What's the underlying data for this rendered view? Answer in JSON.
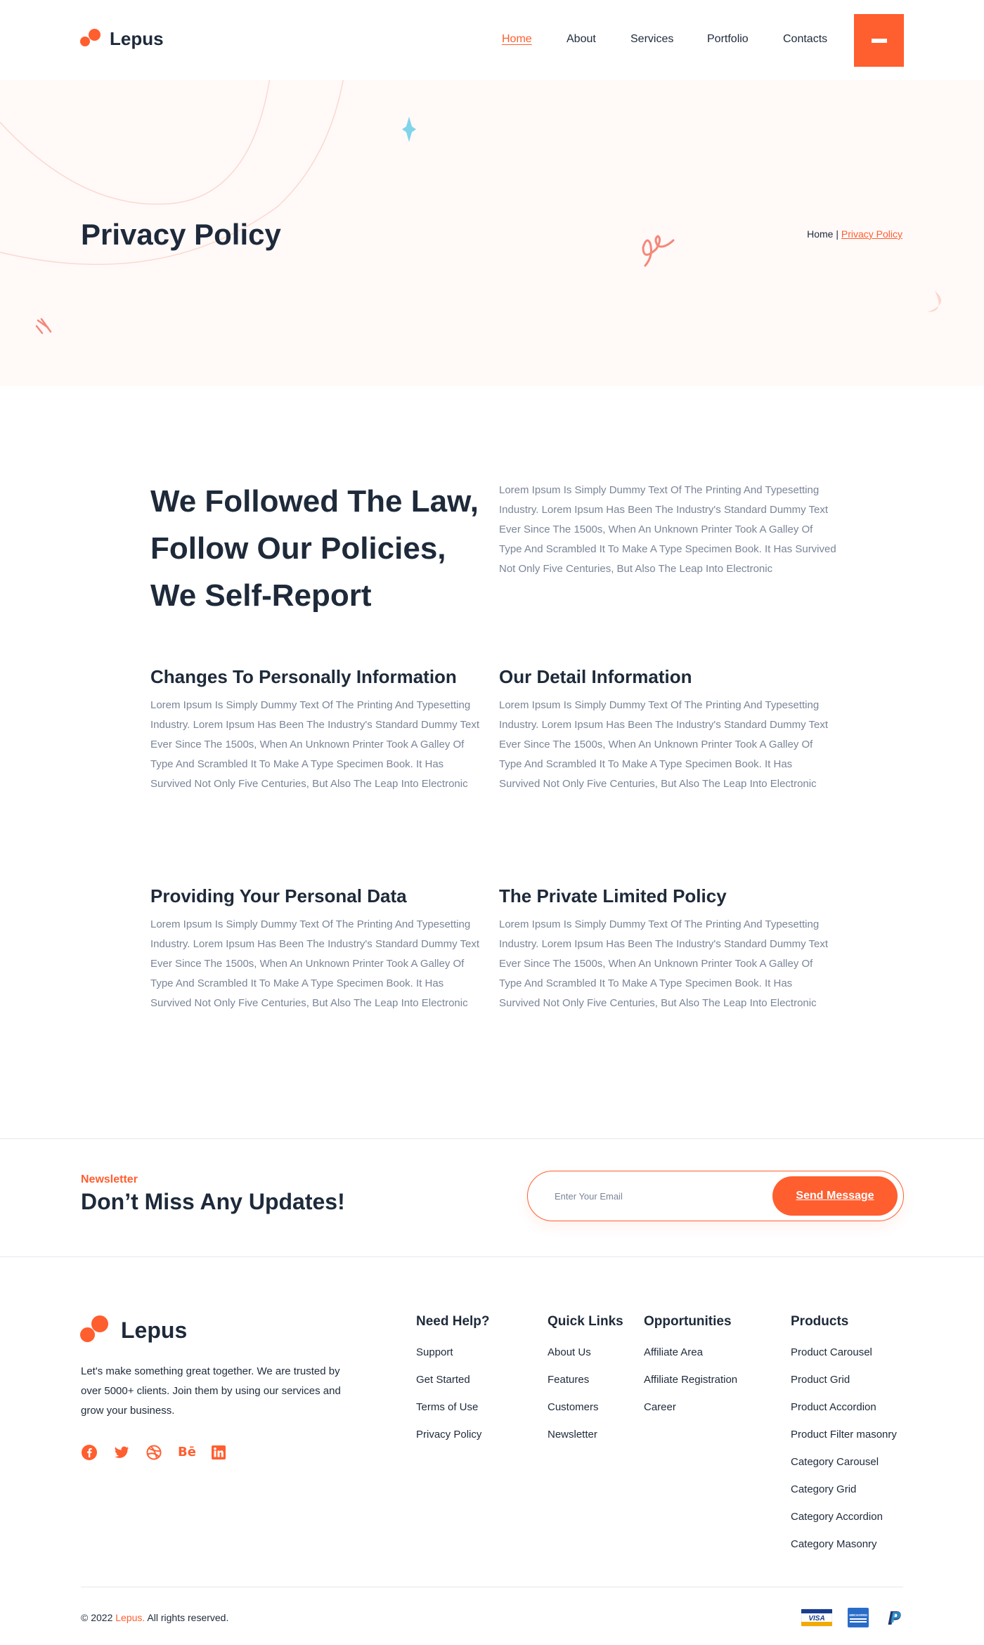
{
  "brand": {
    "name": "Lepus",
    "accent": "#ff5e2f",
    "dark": "#1e2a3a",
    "muted": "#7a8597"
  },
  "nav": {
    "items": [
      {
        "label": "Home",
        "active": true
      },
      {
        "label": "About"
      },
      {
        "label": "Services"
      },
      {
        "label": "Portfolio"
      },
      {
        "label": "Contacts"
      }
    ],
    "menu_icon": "hamburger-icon"
  },
  "hero": {
    "title": "Privacy Policy",
    "breadcrumb": {
      "home": "Home",
      "separator": "|",
      "current": "Privacy Policy"
    }
  },
  "intro": {
    "title_lines": [
      "We Followed The Law,",
      "Follow Our Policies,",
      "We Self-Report"
    ],
    "text": "Lorem Ipsum Is Simply Dummy Text Of The Printing And Typesetting Industry. Lorem Ipsum Has Been The Industry's Standard Dummy Text Ever Since The 1500s, When An Unknown Printer Took A Galley Of Type And Scrambled It To Make A Type Specimen Book. It Has Survived Not Only Five Centuries, But Also The Leap Into Electronic"
  },
  "sections": [
    {
      "title": "Changes To Personally Information",
      "text": "Lorem Ipsum Is Simply Dummy Text Of The Printing And Typesetting Industry. Lorem Ipsum Has Been The Industry's Standard Dummy Text Ever Since The 1500s, When An Unknown Printer Took A Galley Of Type And Scrambled It To Make A Type Specimen Book. It Has Survived Not Only Five Centuries, But Also The Leap Into Electronic"
    },
    {
      "title": "Our Detail Information",
      "text": "Lorem Ipsum Is Simply Dummy Text Of The Printing And Typesetting Industry. Lorem Ipsum Has Been The Industry's Standard Dummy Text Ever Since The 1500s, When An Unknown Printer Took A Galley Of Type And Scrambled It To Make A Type Specimen Book. It Has Survived Not Only Five Centuries, But Also The Leap Into Electronic"
    },
    {
      "title": "Providing Your Personal Data",
      "text": "Lorem Ipsum Is Simply Dummy Text Of The Printing And Typesetting Industry. Lorem Ipsum Has Been The Industry's Standard Dummy Text Ever Since The 1500s, When An Unknown Printer Took A Galley Of Type And Scrambled It To Make A Type Specimen Book. It Has Survived Not Only Five Centuries, But Also The Leap Into Electronic"
    },
    {
      "title": "The Private Limited Policy",
      "text": "Lorem Ipsum Is Simply Dummy Text Of The Printing And Typesetting Industry. Lorem Ipsum Has Been The Industry's Standard Dummy Text Ever Since The 1500s, When An Unknown Printer Took A Galley Of Type And Scrambled It To Make A Type Specimen Book. It Has Survived Not Only Five Centuries, But Also The Leap Into Electronic"
    }
  ],
  "newsletter": {
    "label": "Newsletter",
    "title": "Don’t Miss Any Updates!",
    "placeholder": "Enter Your Email",
    "button": "Send Message"
  },
  "footer": {
    "logo_text": "Lepus",
    "about": "Let's make something great together. We are trusted by over 5000+ clients. Join them by using our services and grow your business.",
    "social": [
      "facebook-icon",
      "twitter-icon",
      "dribbble-icon",
      "behance-icon",
      "linkedin-icon"
    ],
    "behance_text": "Bē",
    "columns": [
      {
        "title": "Need Help?",
        "links": [
          "Support",
          "Get Started",
          "Terms of Use",
          "Privacy Policy"
        ]
      },
      {
        "title": "Quick Links",
        "links": [
          "About Us",
          "Features",
          "Customers",
          "Newsletter"
        ]
      },
      {
        "title": "Opportunities",
        "links": [
          "Affiliate Area",
          "Affiliate Registration",
          "Career"
        ]
      },
      {
        "title": "Products",
        "links": [
          "Product Carousel",
          "Product Grid",
          "Product Accordion",
          "Product Filter masonry",
          "Category Carousel",
          "Category Grid",
          "Category Accordion",
          "Category Masonry"
        ]
      }
    ],
    "copyright_prefix": "© 2022",
    "copyright_brand": "Lepus.",
    "copyright_suffix": "All rights reserved.",
    "payments": [
      {
        "icon": "visa-icon",
        "text": "VISA"
      },
      {
        "icon": "amex-icon",
        "text": "AMERICAN EXPRESS"
      },
      {
        "icon": "paypal-icon",
        "text": "P"
      }
    ]
  }
}
